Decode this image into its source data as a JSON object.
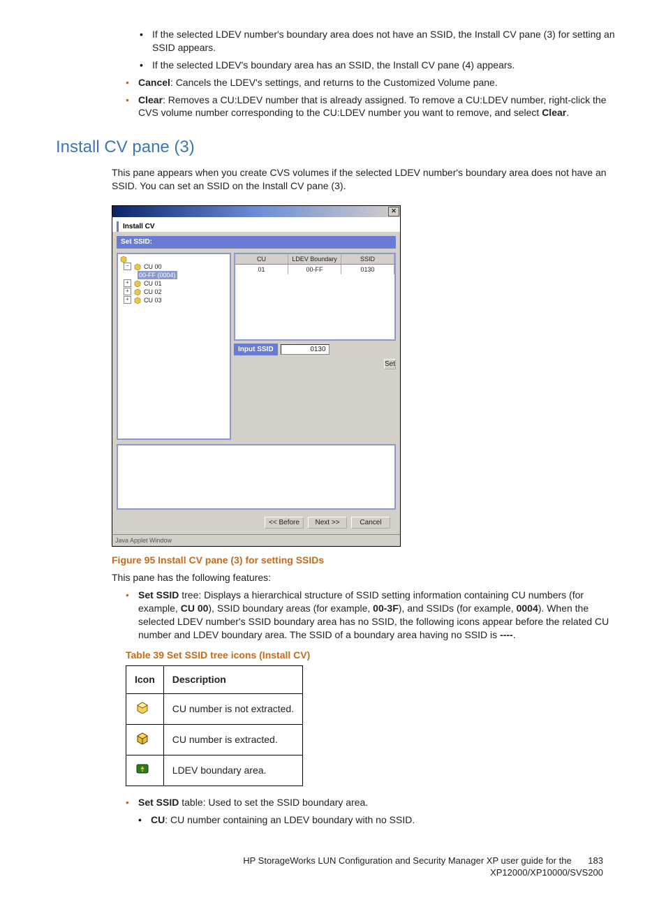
{
  "top_list": {
    "sub1": "If the selected LDEV number's boundary area does not have an SSID, the Install CV pane (3) for setting an SSID appears.",
    "sub2": "If the selected LDEV's boundary area has an SSID, the Install CV pane (4) appears.",
    "cancel_label": "Cancel",
    "cancel_text": ": Cancels the LDEV's settings, and returns to the Customized Volume pane.",
    "clear_label": "Clear",
    "clear_text_1": ": Removes a CU:LDEV number that is already assigned. To remove a CU:LDEV number, right-click the CVS volume number corresponding to the CU:LDEV number you want to remove, and select ",
    "clear_text_2": "Clear",
    "clear_text_3": "."
  },
  "section_heading": "Install CV pane (3)",
  "section_intro": "This pane appears when you create CVS volumes if the selected LDEV number's boundary area does not have an SSID. You can set an SSID on the Install CV pane (3).",
  "dialog": {
    "tab": "Install CV",
    "set_ssid": "Set SSID:",
    "tree": {
      "cu00": "CU 00",
      "sel": "00-FF (0004)",
      "cu01": "CU 01",
      "cu02": "CU 02",
      "cu03": "CU 03"
    },
    "table": {
      "h1": "CU",
      "h2": "LDEV Boundary",
      "h3": "SSID",
      "r1c1": "01",
      "r1c2": "00-FF",
      "r1c3": "0130"
    },
    "input_label": "Input SSID",
    "input_value": "0130",
    "set_btn": "Set",
    "before_btn": "<< Before",
    "next_btn": "Next >>",
    "cancel_btn": "Cancel",
    "status": "Java Applet Window"
  },
  "figure_caption": "Figure 95 Install CV pane (3) for setting SSIDs",
  "features_intro": "This pane has the following features:",
  "set_ssid_tree": {
    "label": "Set SSID",
    "text1": " tree: Displays a hierarchical structure of SSID setting information containing CU numbers (for example, ",
    "cu_ex": "CU 00",
    "text2": "), SSID boundary areas (for example, ",
    "bound_ex": "00-3F",
    "text3": "), and SSIDs (for example, ",
    "ssid_ex": "0004",
    "text4": "). When the selected LDEV number's SSID boundary area has no SSID, the following icons appear before the related CU number and LDEV boundary area. The SSID of a boundary area having no SSID is ",
    "dashes": "----",
    "text5": "."
  },
  "table_caption": "Table 39 Set SSID tree icons (Install CV)",
  "icons_table": {
    "h_icon": "Icon",
    "h_desc": "Description",
    "r1": "CU number is not extracted.",
    "r2": "CU number is extracted.",
    "r3": "LDEV boundary area."
  },
  "set_ssid_table": {
    "label": "Set SSID",
    "text": " table: Used to set the SSID boundary area.",
    "cu_label": "CU",
    "cu_text": ": CU number containing an LDEV boundary with no SSID."
  },
  "footer": {
    "line1": "HP StorageWorks LUN Configuration and Security Manager XP user guide for the",
    "line2": "XP12000/XP10000/SVS200",
    "page": "183"
  }
}
